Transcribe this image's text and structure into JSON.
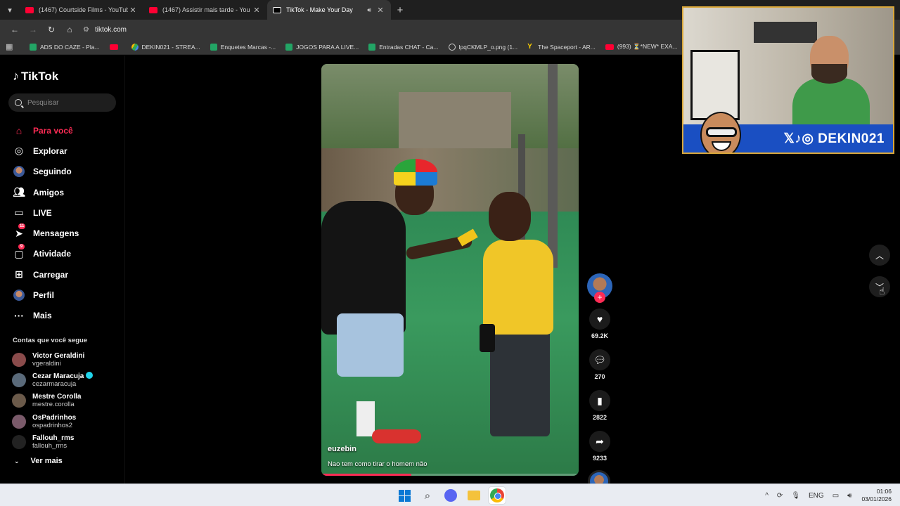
{
  "browser": {
    "tabs": [
      {
        "title": "(1467) Courtside Films - YouTub",
        "icon": "youtube-icon",
        "active": false
      },
      {
        "title": "(1467) Assistir mais tarde - You",
        "icon": "youtube-icon",
        "active": false
      },
      {
        "title": "TikTok - Make Your Day",
        "icon": "tiktok-icon",
        "active": true
      }
    ],
    "new_tab": "+",
    "url": "tiktok.com",
    "bookmarks": [
      {
        "label": "ADS DO CAZE - Pla...",
        "icon": "sheets-icon"
      },
      {
        "label": "",
        "icon": "youtube-icon"
      },
      {
        "label": "DEKIN021 - STREA...",
        "icon": "drive-icon"
      },
      {
        "label": "Enquetes Marcas -...",
        "icon": "sheets-icon"
      },
      {
        "label": "JOGOS PARA A LIVE...",
        "icon": "sheets-icon"
      },
      {
        "label": "Entradas CHAT - Ca...",
        "icon": "sheets-icon"
      },
      {
        "label": "lpqCKMLP_o.png (1...",
        "icon": "globe-icon"
      },
      {
        "label": "The Spaceport - AR...",
        "icon": "y-icon"
      },
      {
        "label": "(993) ⏳*NEW* EXA...",
        "icon": "youtube-icon"
      }
    ]
  },
  "tiktok": {
    "logo": "TikTok",
    "search_placeholder": "Pesquisar",
    "nav": [
      {
        "label": "Para você",
        "icon": "home-icon",
        "active": true,
        "badge": ""
      },
      {
        "label": "Explorar",
        "icon": "compass-icon",
        "active": false,
        "badge": ""
      },
      {
        "label": "Seguindo",
        "icon": "following-icon",
        "active": false,
        "badge": ""
      },
      {
        "label": "Amigos",
        "icon": "friends-icon",
        "active": false,
        "badge": ""
      },
      {
        "label": "LIVE",
        "icon": "live-icon",
        "active": false,
        "badge": ""
      },
      {
        "label": "Mensagens",
        "icon": "messages-icon",
        "active": false,
        "badge": "11"
      },
      {
        "label": "Atividade",
        "icon": "activity-icon",
        "active": false,
        "badge": "9"
      },
      {
        "label": "Carregar",
        "icon": "upload-icon",
        "active": false,
        "badge": ""
      },
      {
        "label": "Perfil",
        "icon": "profile-avatar-icon",
        "active": false,
        "badge": ""
      },
      {
        "label": "Mais",
        "icon": "more-icon",
        "active": false,
        "badge": ""
      }
    ],
    "following_title": "Contas que você segue",
    "following": [
      {
        "name": "Victor Geraldini",
        "handle": "vgeraldini",
        "verified": false,
        "color": "#8a4b4b"
      },
      {
        "name": "Cezar Maracuja",
        "handle": "cezarmaracuja",
        "verified": true,
        "color": "#5a6a7a"
      },
      {
        "name": "Mestre Corolla",
        "handle": "mestre.corolla",
        "verified": false,
        "color": "#6b5a4a"
      },
      {
        "name": "OsPadrinhos",
        "handle": "ospadrinhos2",
        "verified": false,
        "color": "#7a5a6a"
      },
      {
        "name": "Fallouh_rms",
        "handle": "fallouh_rms",
        "verified": false,
        "color": "#222222"
      }
    ],
    "see_more": "Ver mais",
    "video": {
      "username": "euzebin",
      "caption": "Nao tem como tirar o homem não",
      "progress": 0.35
    },
    "actions": {
      "likes": "69.2K",
      "comments": "270",
      "saves": "2822",
      "shares": "9233"
    }
  },
  "overlay": {
    "social_text": "𝕏♪◎ DEKIN021"
  },
  "taskbar": {
    "lang": "ENG",
    "time": "01:06",
    "date": "03/01/2026"
  },
  "colors": {
    "accent": "#fe2c55",
    "banner": "#1a4fc2"
  }
}
